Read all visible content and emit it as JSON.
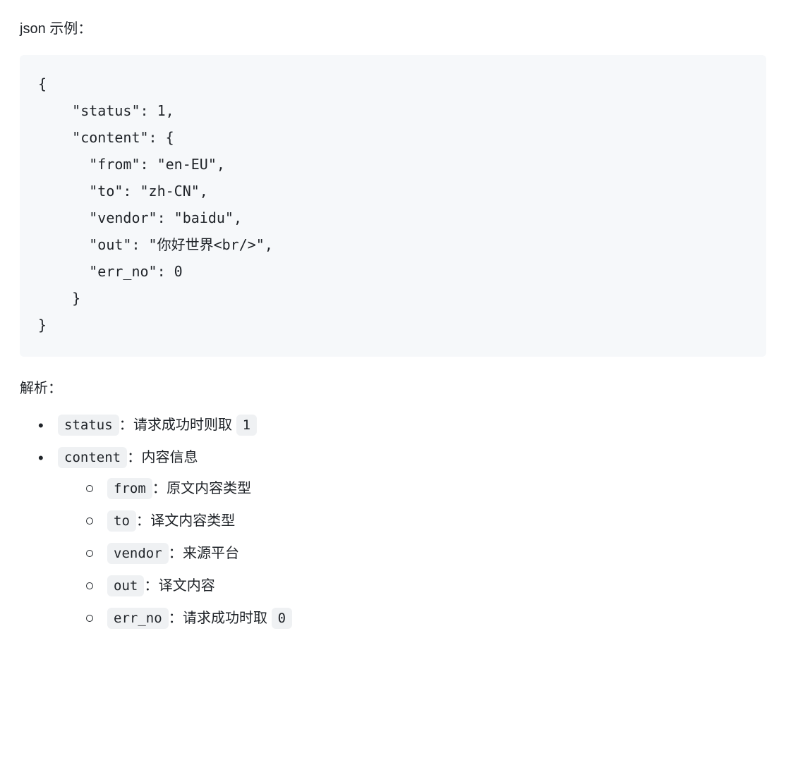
{
  "intro": "json 示例：",
  "code": "{\n    \"status\": 1,\n    \"content\": {\n      \"from\": \"en-EU\",\n      \"to\": \"zh-CN\",\n      \"vendor\": \"baidu\",\n      \"out\": \"你好世界<br/>\",\n      \"err_no\": 0\n    }\n}",
  "section_label": "解析：",
  "items": {
    "status": {
      "key": "status",
      "sep": "：",
      "desc_pre": "请求成功时则取 ",
      "value": "1"
    },
    "content": {
      "key": "content",
      "sep": "：",
      "desc": "内容信息"
    },
    "from": {
      "key": "from",
      "sep": "：",
      "desc": "原文内容类型"
    },
    "to": {
      "key": "to",
      "sep": "：",
      "desc": "译文内容类型"
    },
    "vendor": {
      "key": "vendor",
      "sep": "：",
      "desc": "来源平台"
    },
    "out": {
      "key": "out",
      "sep": "：",
      "desc": "译文内容"
    },
    "err_no": {
      "key": "err_no",
      "sep": "：",
      "desc_pre": "请求成功时取 ",
      "value": "0"
    }
  }
}
